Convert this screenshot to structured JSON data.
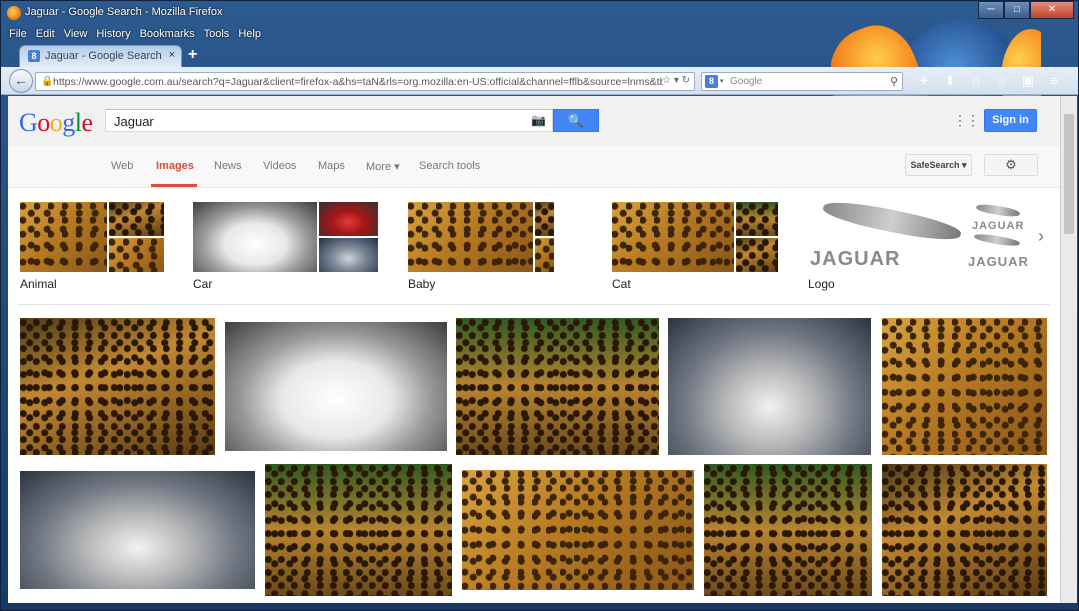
{
  "window": {
    "title": "Jaguar - Google Search - Mozilla Firefox",
    "controls": {
      "minimize": "─",
      "maximize": "□",
      "close": "✕"
    }
  },
  "menu": [
    "File",
    "Edit",
    "View",
    "History",
    "Bookmarks",
    "Tools",
    "Help"
  ],
  "tab": {
    "favicon": "8",
    "label": "Jaguar - Google Search",
    "close": "×",
    "new_tab": "+"
  },
  "nav": {
    "back": "←",
    "url": "https://www.google.com.au/search?q=Jaguar&client=firefox-a&hs=taN&rls=org.mozilla:en-US:official&channel=fflb&source=lnms&tbm=isch&sa=X&ei",
    "url_icons": "☆ ▾ ↻",
    "search_engine": "8",
    "search_caret": "▾",
    "search_placeholder": "Google",
    "search_icon": "⚲",
    "toolbar_icons": [
      "✈",
      "⬇",
      "⌂",
      "☆",
      "▣",
      "≡"
    ]
  },
  "google": {
    "logo": {
      "G": "G",
      "o1": "o",
      "o2": "o",
      "g": "g",
      "l": "l",
      "e": "e"
    },
    "query": "Jaguar",
    "camera_icon": "📷",
    "search_button_icon": "🔍",
    "apps_icon": "⋮⋮⋮",
    "sign_in": "Sign in",
    "tabs": {
      "web": "Web",
      "images": "Images",
      "news": "News",
      "videos": "Videos",
      "maps": "Maps",
      "more": "More ▾",
      "tools": "Search tools"
    },
    "safesearch": "SafeSearch ▾",
    "gear": "⚙"
  },
  "related": [
    {
      "label": "Animal"
    },
    {
      "label": "Car"
    },
    {
      "label": "Baby"
    },
    {
      "label": "Cat"
    },
    {
      "label": "Logo"
    }
  ],
  "related_arrow": "›",
  "logo_text": {
    "big": "JAGUAR",
    "small1": "JAGUAR",
    "small2": "JAGUAR"
  }
}
